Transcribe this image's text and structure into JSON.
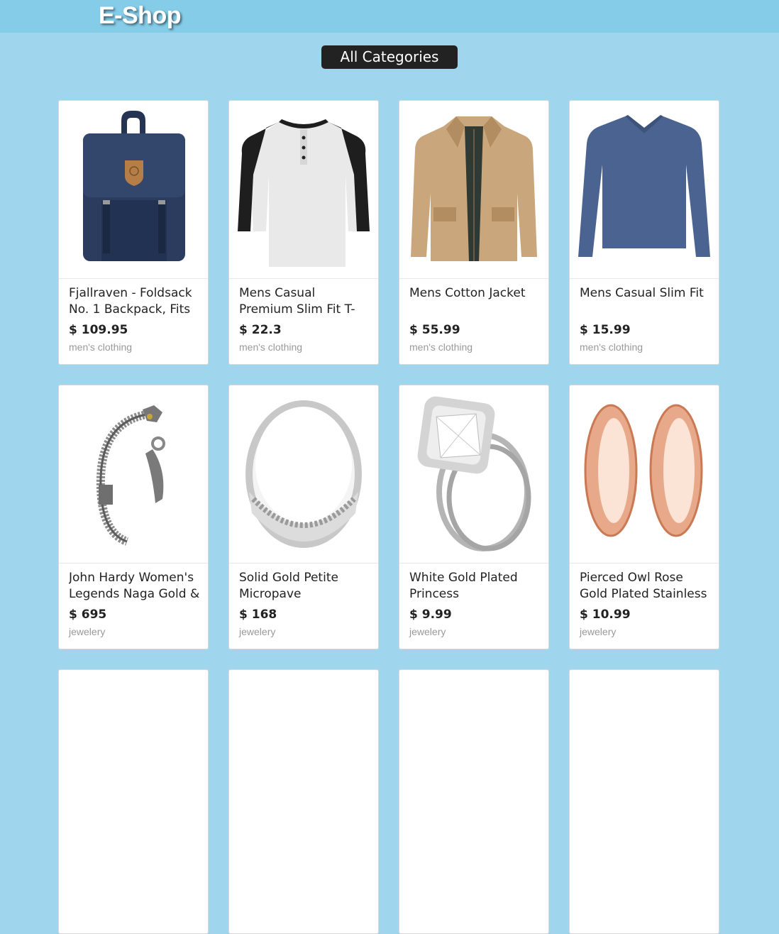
{
  "header": {
    "logo": "E-Shop"
  },
  "filter": {
    "label": "All Categories"
  },
  "products": [
    {
      "title": "Fjallraven - Foldsack No. 1 Backpack, Fits",
      "price": "$ 109.95",
      "category": "men's clothing",
      "icon": "backpack-image"
    },
    {
      "title": "Mens Casual Premium Slim Fit T-Shirts",
      "price": "$ 22.3",
      "category": "men's clothing",
      "icon": "tshirt-image"
    },
    {
      "title": "Mens Cotton Jacket",
      "price": "$ 55.99",
      "category": "men's clothing",
      "icon": "jacket-image"
    },
    {
      "title": "Mens Casual Slim Fit",
      "price": "$ 15.99",
      "category": "men's clothing",
      "icon": "longsleeve-image"
    },
    {
      "title": "John Hardy Women's Legends Naga Gold &",
      "price": "$ 695",
      "category": "jewelery",
      "icon": "bracelet-image"
    },
    {
      "title": "Solid Gold Petite Micropave",
      "price": "$ 168",
      "category": "jewelery",
      "icon": "ring-image"
    },
    {
      "title": "White Gold Plated Princess",
      "price": "$ 9.99",
      "category": "jewelery",
      "icon": "diamond-ring-image"
    },
    {
      "title": "Pierced Owl Rose Gold Plated Stainless Steel",
      "price": "$ 10.99",
      "category": "jewelery",
      "icon": "earring-image"
    },
    {
      "title": "",
      "price": "",
      "category": ""
    },
    {
      "title": "",
      "price": "",
      "category": ""
    },
    {
      "title": "",
      "price": "",
      "category": ""
    },
    {
      "title": "",
      "price": "",
      "category": ""
    }
  ]
}
